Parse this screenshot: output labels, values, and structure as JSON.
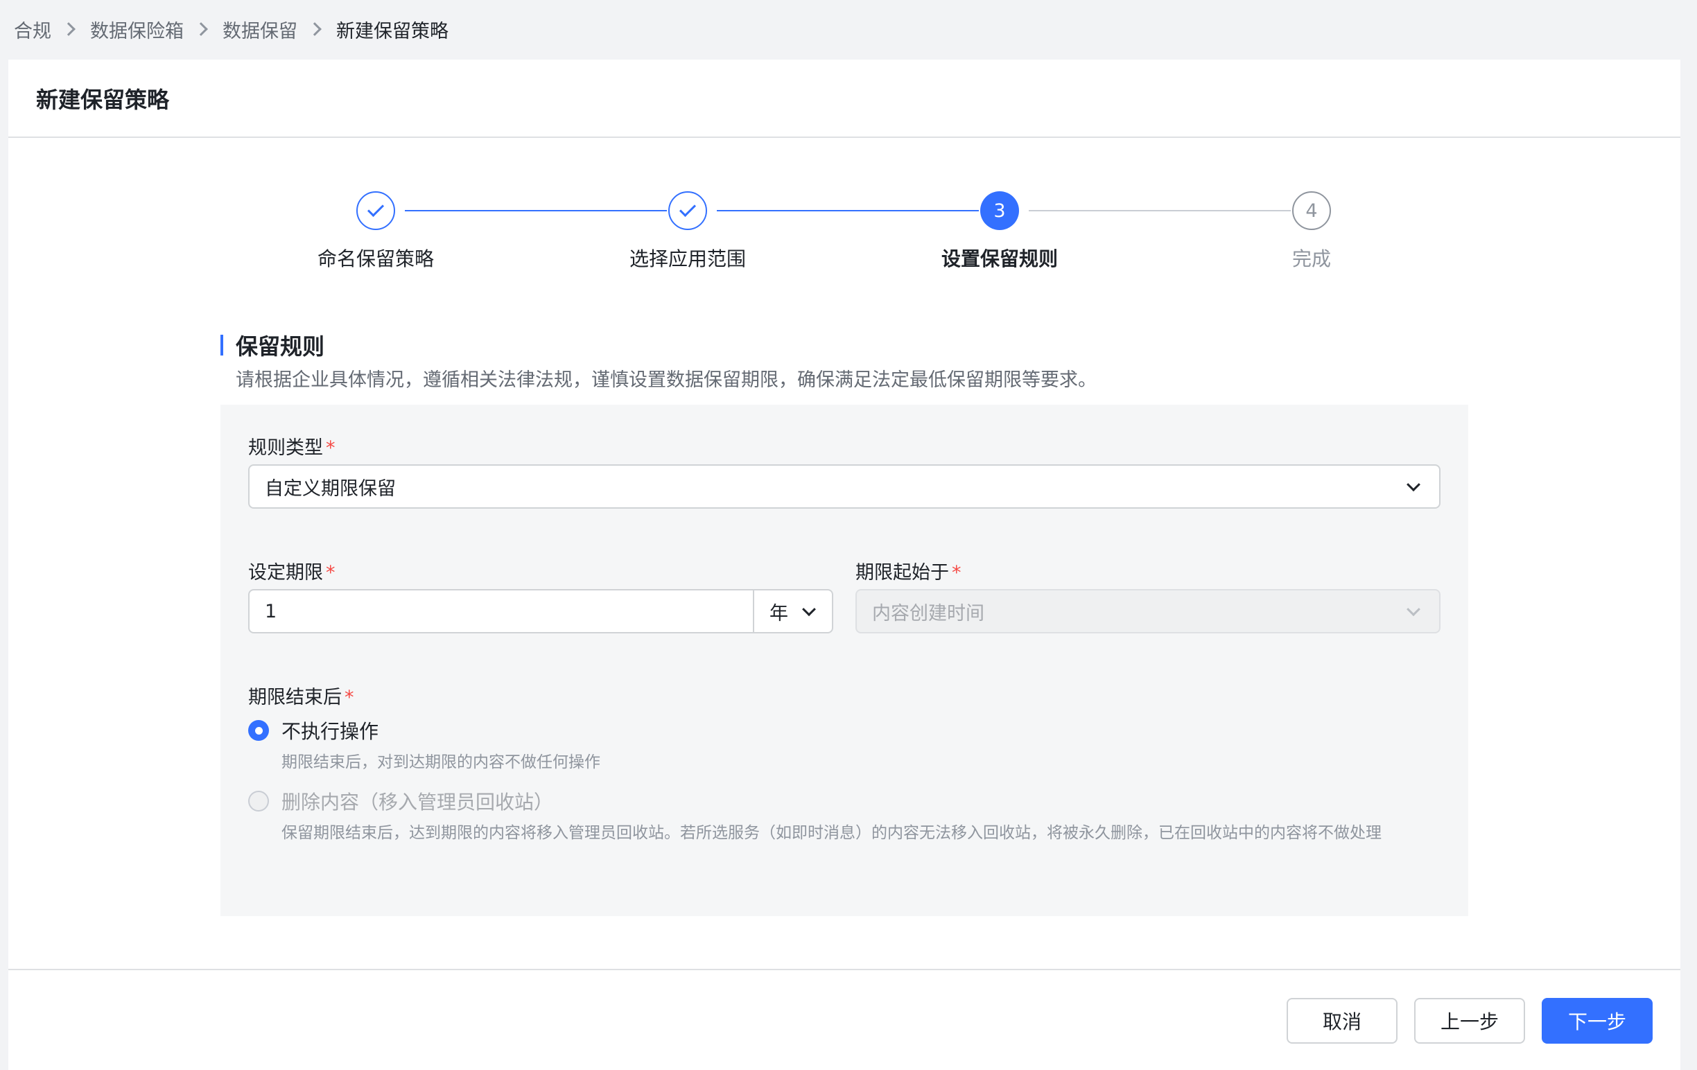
{
  "breadcrumb": [
    "合规",
    "数据保险箱",
    "数据保留",
    "新建保留策略"
  ],
  "page": {
    "title": "新建保留策略"
  },
  "steps": [
    {
      "number": "1",
      "label": "命名保留策略",
      "state": "done"
    },
    {
      "number": "2",
      "label": "选择应用范围",
      "state": "done"
    },
    {
      "number": "3",
      "label": "设置保留规则",
      "state": "active"
    },
    {
      "number": "4",
      "label": "完成",
      "state": "todo"
    }
  ],
  "section": {
    "title": "保留规则",
    "description": "请根据企业具体情况，遵循相关法律法规，谨慎设置数据保留期限，确保满足法定最低保留期限等要求。"
  },
  "form": {
    "rule_type": {
      "label": "规则类型",
      "required_mark": "*",
      "value": "自定义期限保留"
    },
    "period": {
      "label": "设定期限",
      "required_mark": "*",
      "value": "1",
      "unit": "年"
    },
    "period_start": {
      "label": "期限起始于",
      "required_mark": "*",
      "value": "内容创建时间",
      "disabled": true
    },
    "after_period": {
      "label": "期限结束后",
      "required_mark": "*",
      "options": [
        {
          "label": "不执行操作",
          "description": "期限结束后，对到达期限的内容不做任何操作",
          "checked": true,
          "disabled": false
        },
        {
          "label": "删除内容（移入管理员回收站）",
          "description": "保留期限结束后，达到期限的内容将移入管理员回收站。若所选服务（如即时消息）的内容无法移入回收站，将被永久删除，已在回收站中的内容将不做处理",
          "checked": false,
          "disabled": true
        }
      ]
    }
  },
  "footer": {
    "cancel": "取消",
    "previous": "上一步",
    "next": "下一步"
  },
  "colors": {
    "accent": "#3370ff",
    "required": "#f54a45"
  }
}
